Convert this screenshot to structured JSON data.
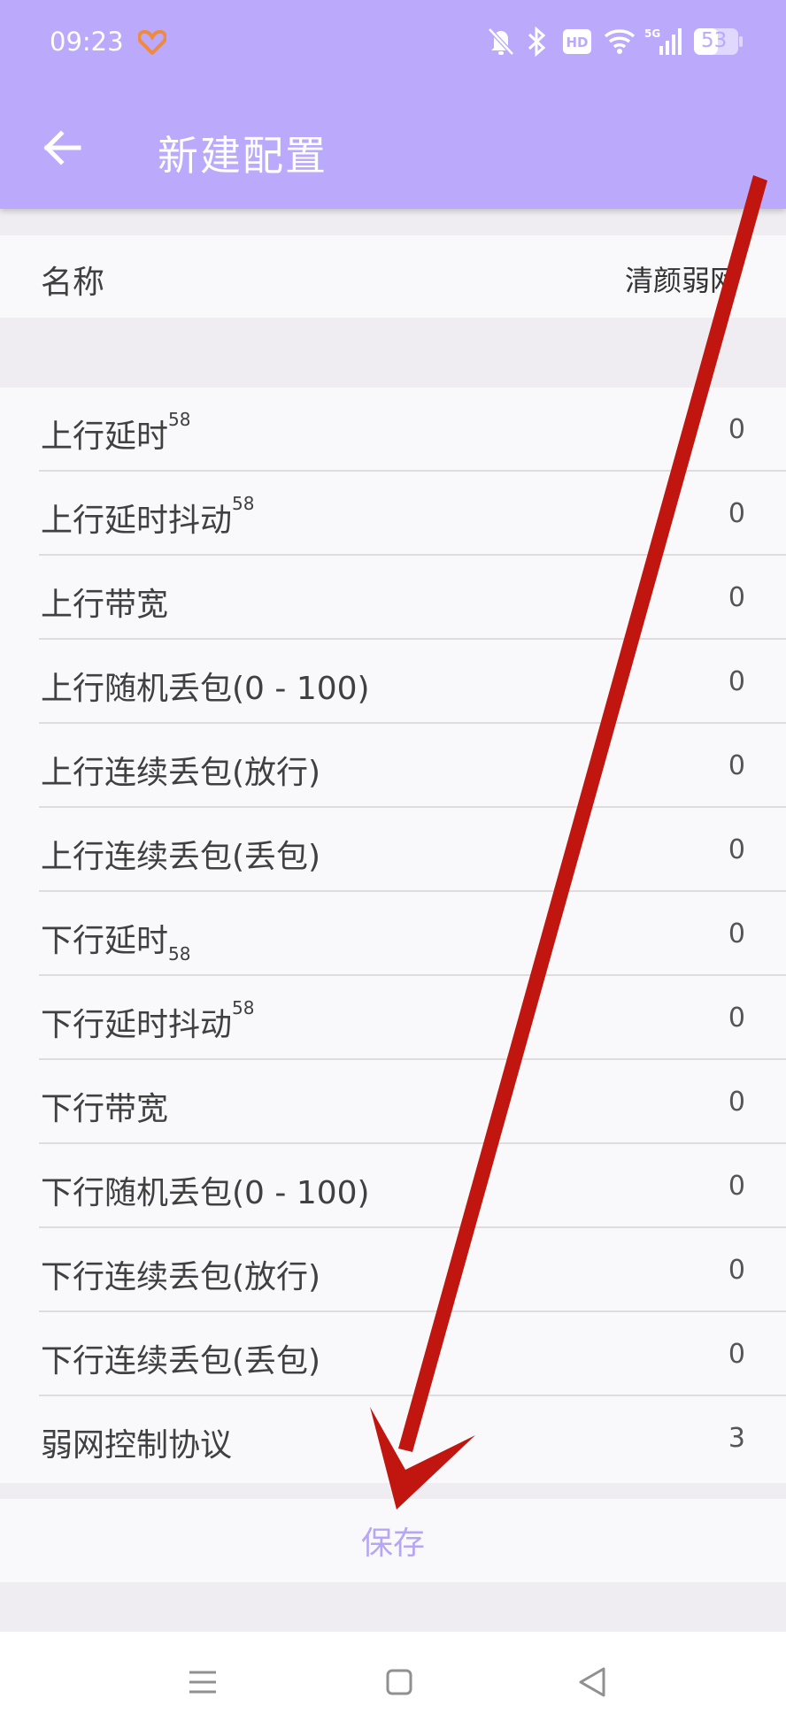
{
  "status_bar": {
    "time": "09:23",
    "battery": "53",
    "icons": [
      "heart-icon",
      "bell-muted-icon",
      "bluetooth-icon",
      "hd-icon",
      "wifi-icon",
      "signal-5g-icon",
      "battery-icon"
    ]
  },
  "toolbar": {
    "title": "新建配置",
    "back_icon": "arrow-left-icon"
  },
  "name_row": {
    "label": "名称",
    "value": "清颜弱网"
  },
  "settings": [
    {
      "label": "上行延时",
      "sup": "58",
      "value": "0"
    },
    {
      "label": "上行延时抖动",
      "sup": "58",
      "value": "0"
    },
    {
      "label": "上行带宽",
      "value": "0"
    },
    {
      "label": "上行随机丢包(0 - 100)",
      "value": "0"
    },
    {
      "label": "上行连续丢包(放行)",
      "value": "0"
    },
    {
      "label": "上行连续丢包(丢包)",
      "value": "0"
    },
    {
      "label": "下行延时",
      "sub": "58",
      "value": "0"
    },
    {
      "label": "下行延时抖动",
      "sup": "58",
      "value": "0"
    },
    {
      "label": "下行带宽",
      "value": "0"
    },
    {
      "label": "下行随机丢包(0 - 100)",
      "value": "0"
    },
    {
      "label": "下行连续丢包(放行)",
      "value": "0"
    },
    {
      "label": "下行连续丢包(丢包)",
      "value": "0"
    },
    {
      "label": "弱网控制协议",
      "value": "3"
    }
  ],
  "save_button": {
    "label": "保存"
  },
  "nav_bar": {
    "icons": [
      "menu-icon",
      "home-square-icon",
      "back-triangle-icon"
    ]
  },
  "colors": {
    "accent": "#bba9fb",
    "save_text": "#b8a6f5",
    "annotation_arrow": "#c0160f"
  }
}
